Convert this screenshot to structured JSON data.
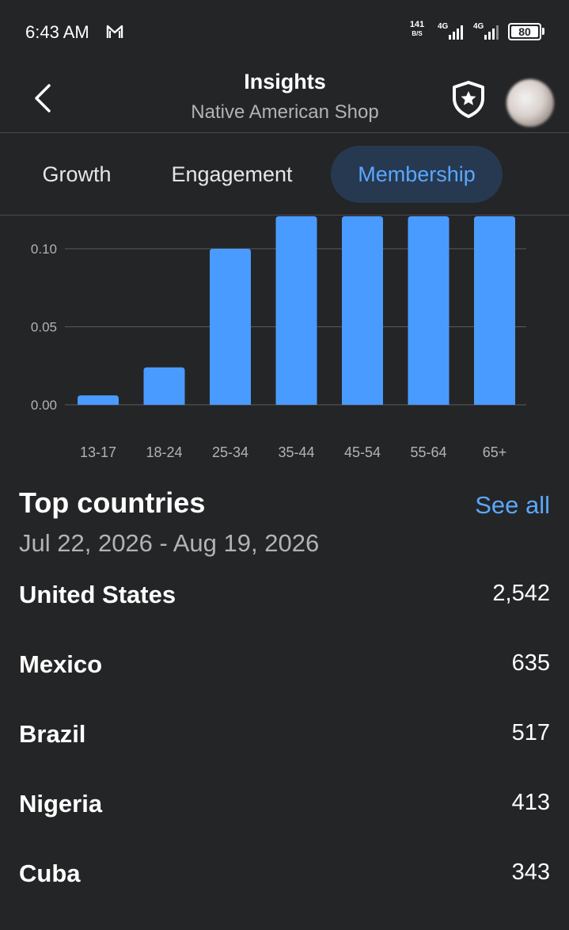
{
  "status": {
    "time": "6:43 AM",
    "net_speed_value": "141",
    "net_speed_unit": "B/S",
    "signal1_label": "4G",
    "signal2_label": "4G",
    "battery": "80"
  },
  "header": {
    "title": "Insights",
    "subtitle": "Native American Shop",
    "back_icon": "chevron-left-icon",
    "shield_icon": "shield-star-icon"
  },
  "tabs": [
    {
      "label": "Growth",
      "active": false
    },
    {
      "label": "Engagement",
      "active": false
    },
    {
      "label": "Membership",
      "active": true
    }
  ],
  "colors": {
    "background": "#242526",
    "accent": "#5aa7ff",
    "bar": "#4a9bff",
    "active_tab_bg": "#263951"
  },
  "chart_data": {
    "type": "bar",
    "categories": [
      "13-17",
      "18-24",
      "25-34",
      "35-44",
      "45-54",
      "55-64",
      "65+"
    ],
    "values": [
      0.006,
      0.024,
      0.1,
      0.2,
      0.2,
      0.2,
      0.2
    ],
    "ytick_labels": [
      "0.00",
      "0.05",
      "0.10"
    ],
    "yticks": [
      0,
      0.05,
      0.1
    ],
    "ylim_visible": [
      0,
      0.12
    ],
    "grid": true,
    "legend": "none"
  },
  "top_countries": {
    "title": "Top countries",
    "see_all": "See all",
    "date_range": "Jul 22, 2026 - Aug 19, 2026",
    "rows": [
      {
        "country": "United States",
        "value": "2,542"
      },
      {
        "country": "Mexico",
        "value": "635"
      },
      {
        "country": "Brazil",
        "value": "517"
      },
      {
        "country": "Nigeria",
        "value": "413"
      },
      {
        "country": "Cuba",
        "value": "343"
      }
    ]
  }
}
